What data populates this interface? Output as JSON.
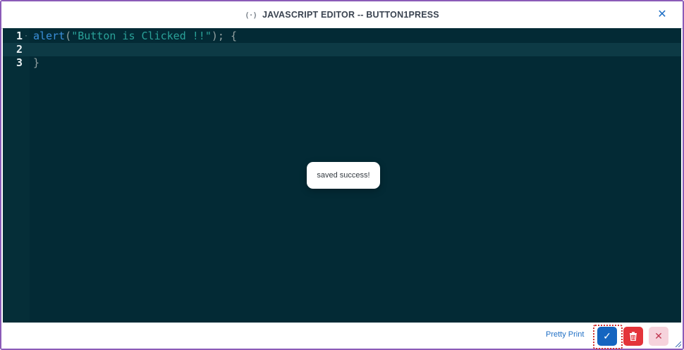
{
  "dialog": {
    "icon_glyph": "(·)",
    "title": "JAVASCRIPT EDITOR -- BUTTON1PRESS",
    "close_glyph": "✕"
  },
  "editor": {
    "line_numbers": [
      "1",
      "2",
      "3"
    ],
    "fold_marker": "·",
    "line1": {
      "fn": "alert",
      "open": "(",
      "str": "\"Button is Clicked !!\"",
      "close": "); {"
    },
    "line2": "",
    "line3": "}"
  },
  "toast": {
    "message": "saved success!"
  },
  "footer": {
    "pretty_print_label": "Pretty Print",
    "save_glyph": "✓",
    "cancel_glyph": "✕"
  },
  "colors": {
    "editor_bg": "#032a35",
    "accent_blue": "#1565c0",
    "delete_red": "#e4343a",
    "frame_purple": "#8b5bb8"
  }
}
